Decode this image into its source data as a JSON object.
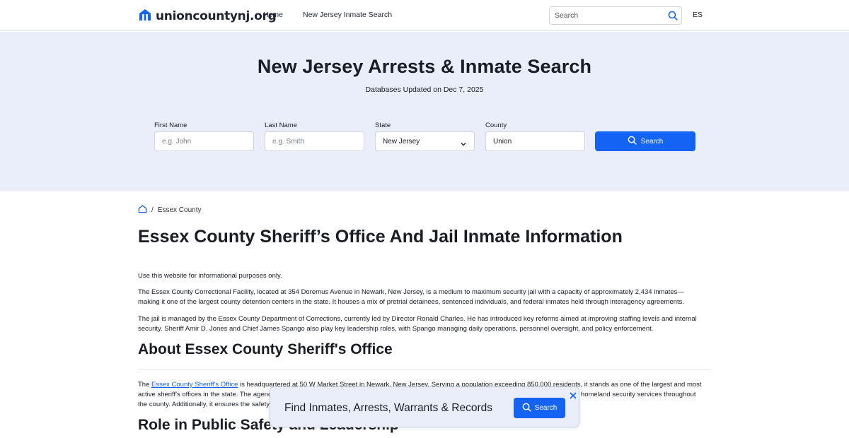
{
  "header": {
    "logo_text": "unioncountynj.org",
    "logo_icon": "house-icon",
    "nav": [
      "Home",
      "New Jersey Inmate Search"
    ],
    "search_placeholder": "Search",
    "lang": "ES"
  },
  "hero": {
    "title": "New Jersey Arrests & Inmate Search",
    "subtitle": "Databases Updated on Dec 7, 2025",
    "fields": {
      "first_name": {
        "label": "First Name",
        "placeholder": "e.g. John"
      },
      "last_name": {
        "label": "Last Name",
        "placeholder": "e.g. Smith"
      },
      "state": {
        "label": "State",
        "value": "New Jersey"
      },
      "county": {
        "label": "County",
        "value": "Union"
      }
    },
    "search_label": "Search"
  },
  "breadcrumb": {
    "separator": "/",
    "current": "Essex County"
  },
  "content": {
    "title": "Essex County Sheriff’s Office And Jail Inmate Information",
    "p1": "Use this website for informational purposes only.",
    "p2": "The Essex County Correctional Facility, located at 354 Doremus Avenue in Newark, New Jersey, is a medium to maximum security jail with a capacity of approximately 2,434 inmates—making it one of the largest county detention centers in the state. It houses a mix of pretrial detainees, sentenced individuals, and federal inmates held through interagency agreements.",
    "p3": "The jail is managed by the Essex County Department of Corrections, currently led by Director Ronald Charles. He has introduced key reforms aimed at improving staffing levels and internal security. Sheriff Amir D. Jones and Chief James Spango also play key leadership roles, with Spango managing daily operations, personnel oversight, and policy enforcement.",
    "h2_about": "About Essex County Sheriff's Office",
    "p4_prefix": "The ",
    "p4_link": "Essex County Sheriff's Office",
    "p4_rest": " is headquartered at 50 W Market Street in Newark, New Jersey. Serving a population exceeding 850,000 residents, it stands as one of the largest and most active sheriff's offices in the state. The agenc",
    "p4_tail": "d homeland security services throughout",
    "p4_line3": "the county. Additionally, it ensures the safety",
    "h2_role": "Role in Public Safety and Leadership"
  },
  "banner": {
    "text": "Find Inmates, Arrests, Warrants & Records",
    "button": "Search",
    "close_icon": "close-icon"
  },
  "colors": {
    "accent": "#1463f3",
    "hero_bg": "#e9eefa",
    "text": "#1a1d26"
  }
}
